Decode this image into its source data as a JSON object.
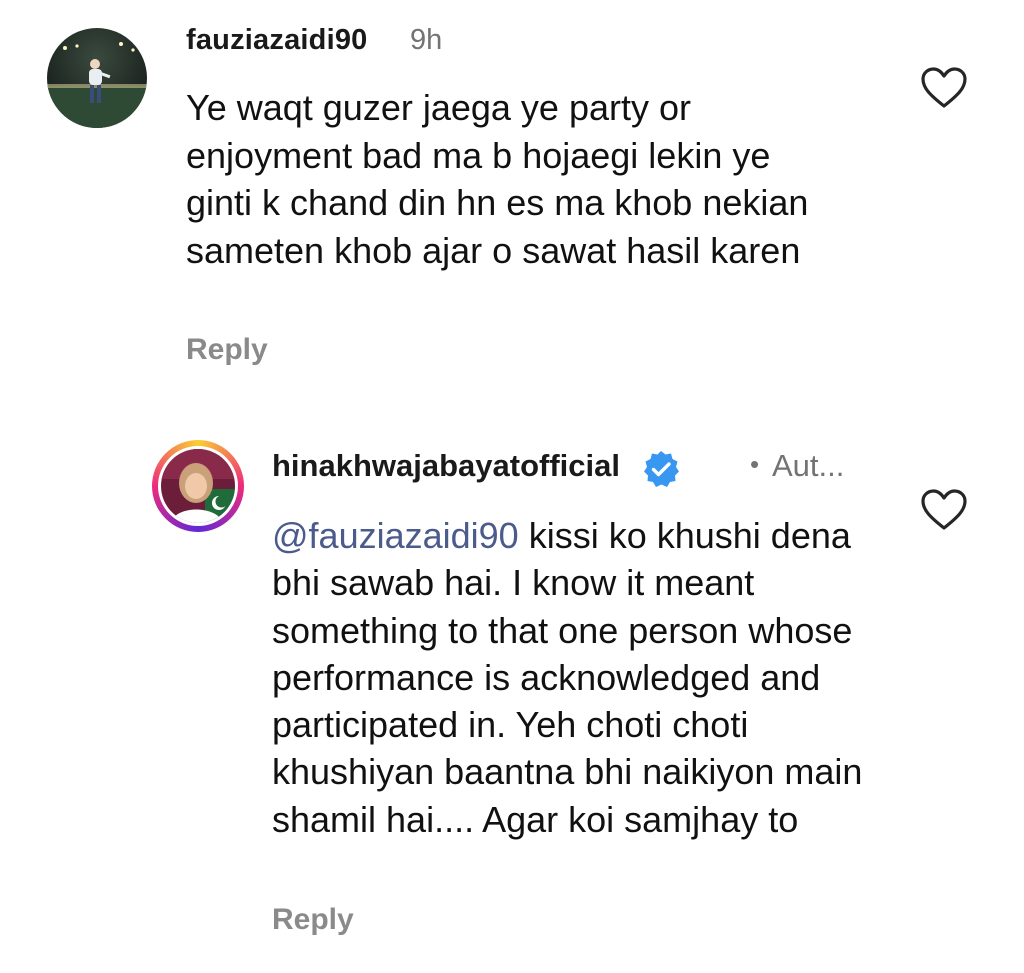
{
  "comments": [
    {
      "username": "fauziazaidi90",
      "time": "9h",
      "text": "Ye waqt guzer jaega ye party or enjoyment bad ma b hojaegi lekin ye ginti k chand din hn es ma khob nekian sameten khob ajar o sawat hasil karen",
      "reply_label": "Reply",
      "like_icon": "heart-outline-icon"
    },
    {
      "username": "hinakhwajabayatofficial",
      "verified": true,
      "meta": "Aut...",
      "mention": "@fauziazaidi90",
      "text": " kissi ko khushi dena bhi sawab hai. I know it meant something to that one person whose performance is acknowledged and participated in. Yeh choti choti khushiyan baantna bhi naikiyon main shamil hai.... Agar koi samjhay to",
      "reply_label": "Reply",
      "like_icon": "heart-outline-icon"
    }
  ],
  "colors": {
    "mention": "#4a5b8c",
    "verified_badge": "#3897f0",
    "secondary_text": "#737373",
    "reply_text": "#8a8a8a"
  }
}
